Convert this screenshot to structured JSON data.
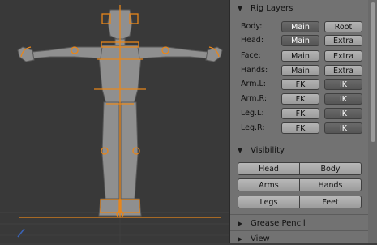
{
  "rig_layers": {
    "title": "Rig Layers",
    "rows": [
      {
        "label": "Body:",
        "a": "Main",
        "b": "Root"
      },
      {
        "label": "Head:",
        "a": "Main",
        "b": "Extra"
      },
      {
        "label": "Face:",
        "a": "Main",
        "b": "Extra"
      },
      {
        "label": "Hands:",
        "a": "Main",
        "b": "Extra"
      },
      {
        "label": "Arm.L:",
        "a": "FK",
        "b": "IK"
      },
      {
        "label": "Arm.R:",
        "a": "FK",
        "b": "IK"
      },
      {
        "label": "Leg.L:",
        "a": "FK",
        "b": "IK"
      },
      {
        "label": "Leg.R:",
        "a": "FK",
        "b": "IK"
      }
    ]
  },
  "visibility": {
    "title": "Visibility",
    "buttons": [
      "Head",
      "Body",
      "Arms",
      "Hands",
      "Legs",
      "Feet"
    ]
  },
  "grease_pencil": {
    "title": "Grease Pencil"
  },
  "view": {
    "title": "View"
  },
  "colors": {
    "bone_orange": "#e8861a",
    "mesh_gray": "#8e8e8e",
    "panel_bg": "#727272"
  }
}
